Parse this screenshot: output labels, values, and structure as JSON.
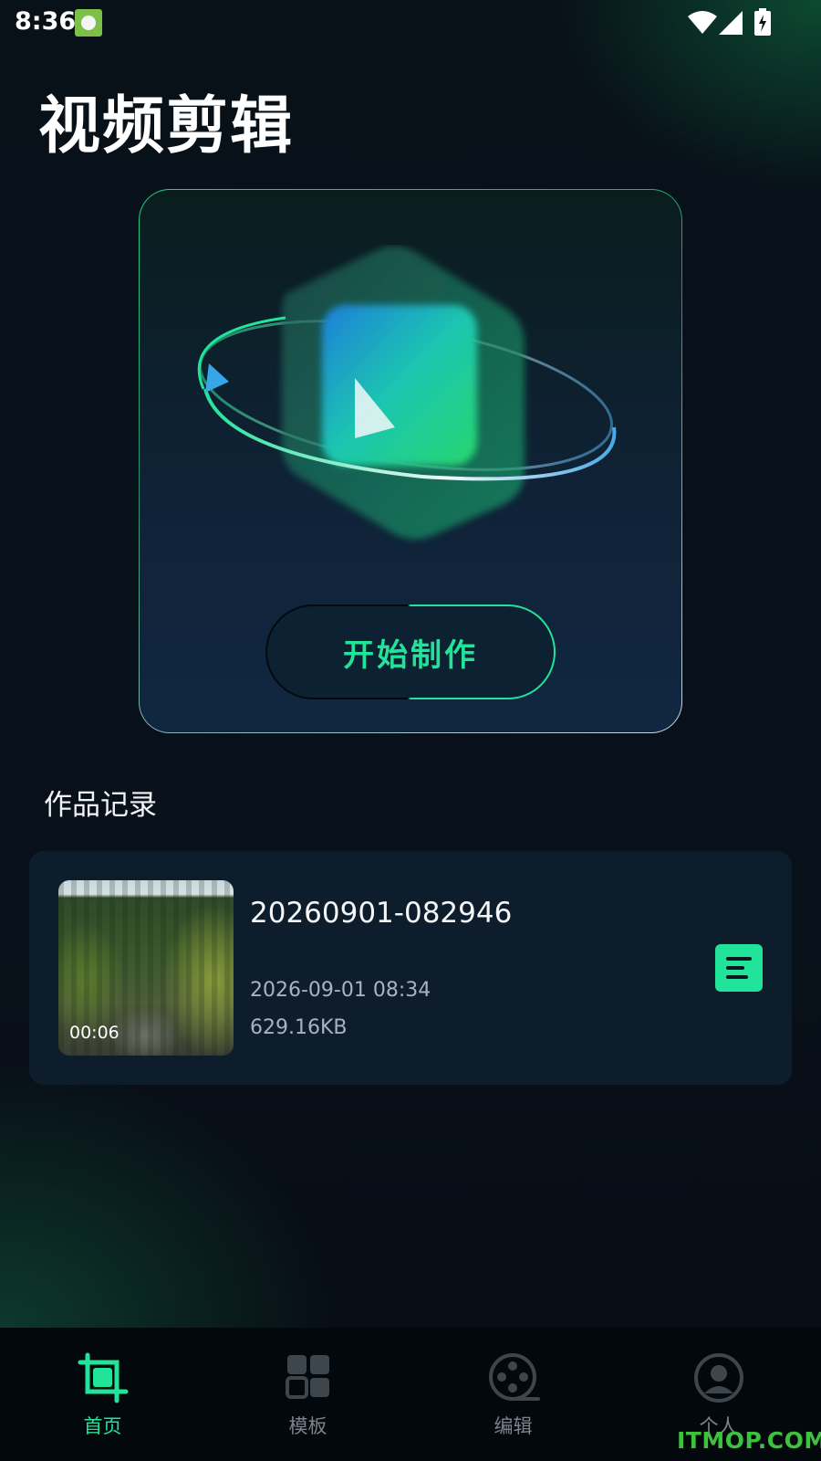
{
  "status_bar": {
    "time": "8:36"
  },
  "header": {
    "title": "视频剪辑"
  },
  "hero": {
    "start_button_label": "开始制作"
  },
  "works": {
    "section_title": "作品记录",
    "items": [
      {
        "name": "20260901-082946",
        "date": "2026-09-01 08:34",
        "size": "629.16KB",
        "duration": "00:06"
      }
    ]
  },
  "bottom_nav": {
    "items": [
      {
        "label": "首页",
        "icon": "crop-icon",
        "active": true
      },
      {
        "label": "模板",
        "icon": "template-grid-icon",
        "active": false
      },
      {
        "label": "编辑",
        "icon": "film-reel-icon",
        "active": false
      },
      {
        "label": "个人",
        "icon": "user-icon",
        "active": false
      }
    ]
  },
  "watermark": "ITMOP.COM",
  "colors": {
    "accent": "#22e39a",
    "background": "#070d14",
    "card": "#0e1d2c"
  }
}
